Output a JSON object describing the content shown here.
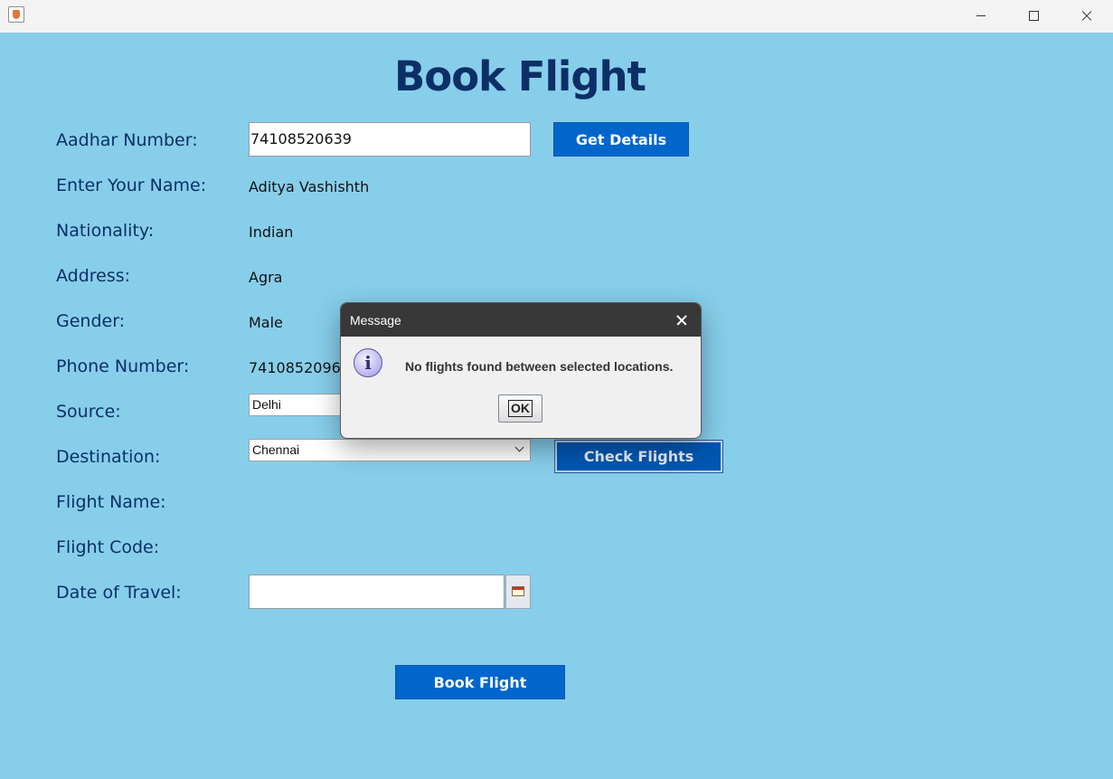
{
  "window": {
    "icon": "java-cup-icon",
    "controls": [
      "minimize-icon",
      "maximize-icon",
      "close-icon"
    ]
  },
  "page": {
    "title": "Book Flight"
  },
  "form": {
    "aadhar_label": "Aadhar Number:",
    "aadhar_value": "74108520639",
    "get_details_label": "Get Details",
    "name_label": "Enter Your Name:",
    "name_value": "Aditya Vashishth",
    "nationality_label": "Nationality:",
    "nationality_value": "Indian",
    "address_label": "Address:",
    "address_value": "Agra",
    "gender_label": "Gender:",
    "gender_value": "Male",
    "phone_label": "Phone Number:",
    "phone_value": "7410852096",
    "source_label": "Source:",
    "source_value": "Delhi",
    "destination_label": "Destination:",
    "destination_value": "Chennai",
    "check_flights_label": "Check Flights",
    "flight_name_label": "Flight Name:",
    "flight_code_label": "Flight Code:",
    "date_label": "Date of Travel:",
    "date_value": "",
    "book_flight_label": "Book Flight"
  },
  "dialog": {
    "title": "Message",
    "message": "No flights found between selected locations.",
    "ok_label": "OK",
    "icon": "information-icon"
  },
  "colors": {
    "background": "#87ceeb",
    "heading": "#0b2f66",
    "button": "#0066cc",
    "dialog_titlebar": "#383838"
  }
}
